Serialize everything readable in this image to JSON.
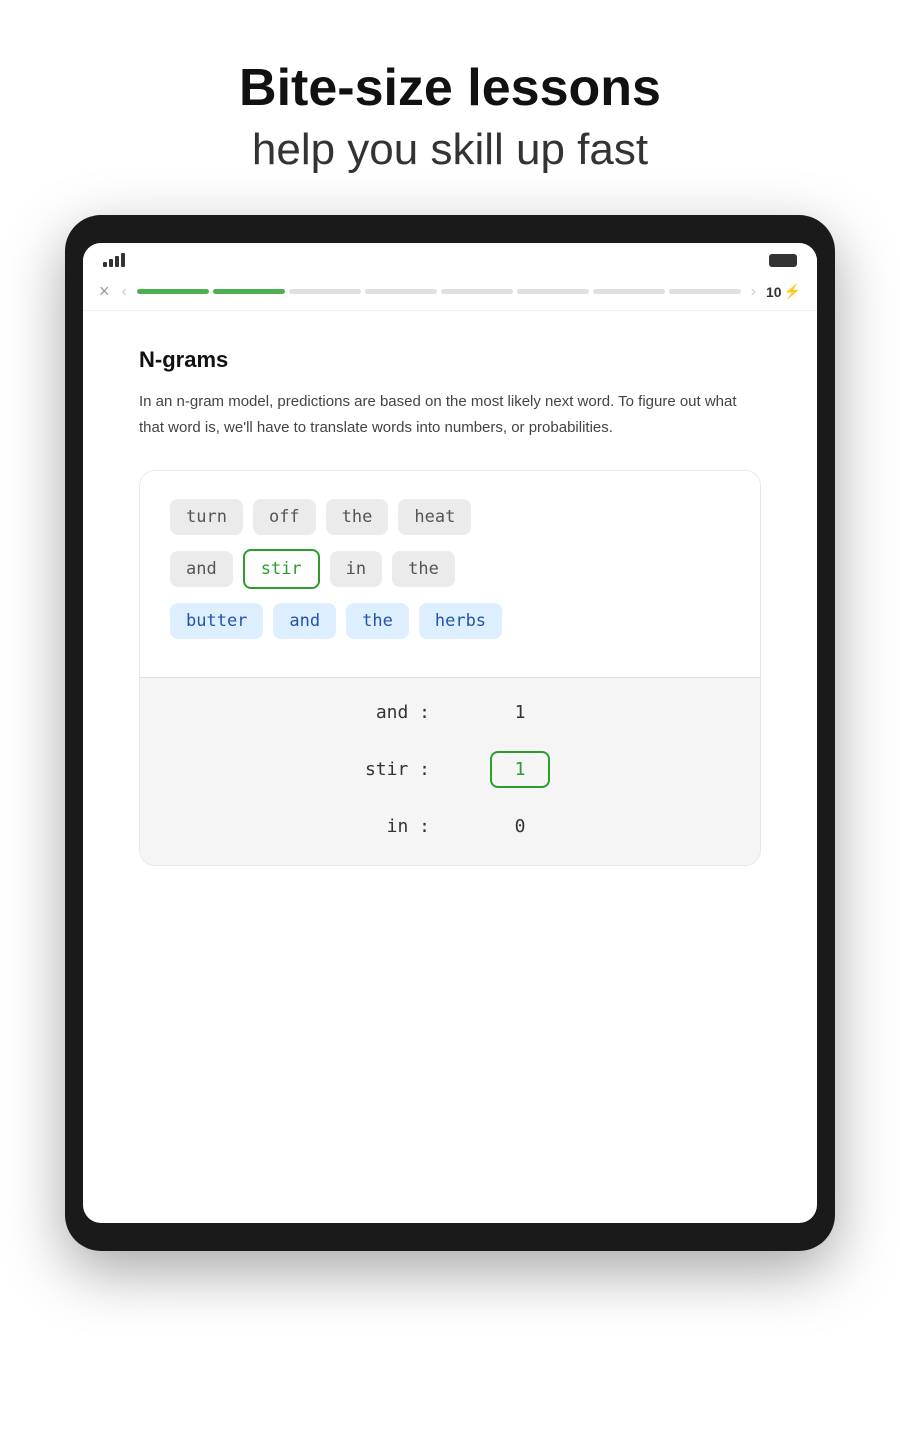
{
  "header": {
    "title_bold": "Bite-size lessons",
    "title_light": "help you skill up fast"
  },
  "status_bar": {
    "signal": "signal",
    "battery": "battery",
    "xp": "10",
    "bolt": "⚡"
  },
  "nav": {
    "close": "×",
    "prev": "‹",
    "next": "›",
    "progress_segments": [
      {
        "type": "done-green"
      },
      {
        "type": "done-green2"
      },
      {
        "type": "pending"
      },
      {
        "type": "pending"
      },
      {
        "type": "pending"
      },
      {
        "type": "pending"
      },
      {
        "type": "pending"
      },
      {
        "type": "pending"
      }
    ]
  },
  "lesson": {
    "title": "N-grams",
    "description": "In an n-gram model, predictions are based on the most likely next word. To figure out what that word is, we'll have to translate words into numbers, or probabilities."
  },
  "word_lines": [
    [
      {
        "text": "turn",
        "style": "gray"
      },
      {
        "text": "off",
        "style": "gray"
      },
      {
        "text": "the",
        "style": "gray"
      },
      {
        "text": "heat",
        "style": "gray"
      }
    ],
    [
      {
        "text": "and",
        "style": "gray"
      },
      {
        "text": "stir",
        "style": "green-outline"
      },
      {
        "text": "in",
        "style": "gray"
      },
      {
        "text": "the",
        "style": "gray"
      }
    ],
    [
      {
        "text": "butter",
        "style": "blue"
      },
      {
        "text": "and",
        "style": "blue"
      },
      {
        "text": "the",
        "style": "blue"
      },
      {
        "text": "herbs",
        "style": "blue"
      }
    ]
  ],
  "table_rows": [
    {
      "key": "and :",
      "value": "1",
      "boxed": false
    },
    {
      "key": "stir :",
      "value": "1",
      "boxed": true
    },
    {
      "key": "in :",
      "value": "0",
      "boxed": false
    }
  ]
}
